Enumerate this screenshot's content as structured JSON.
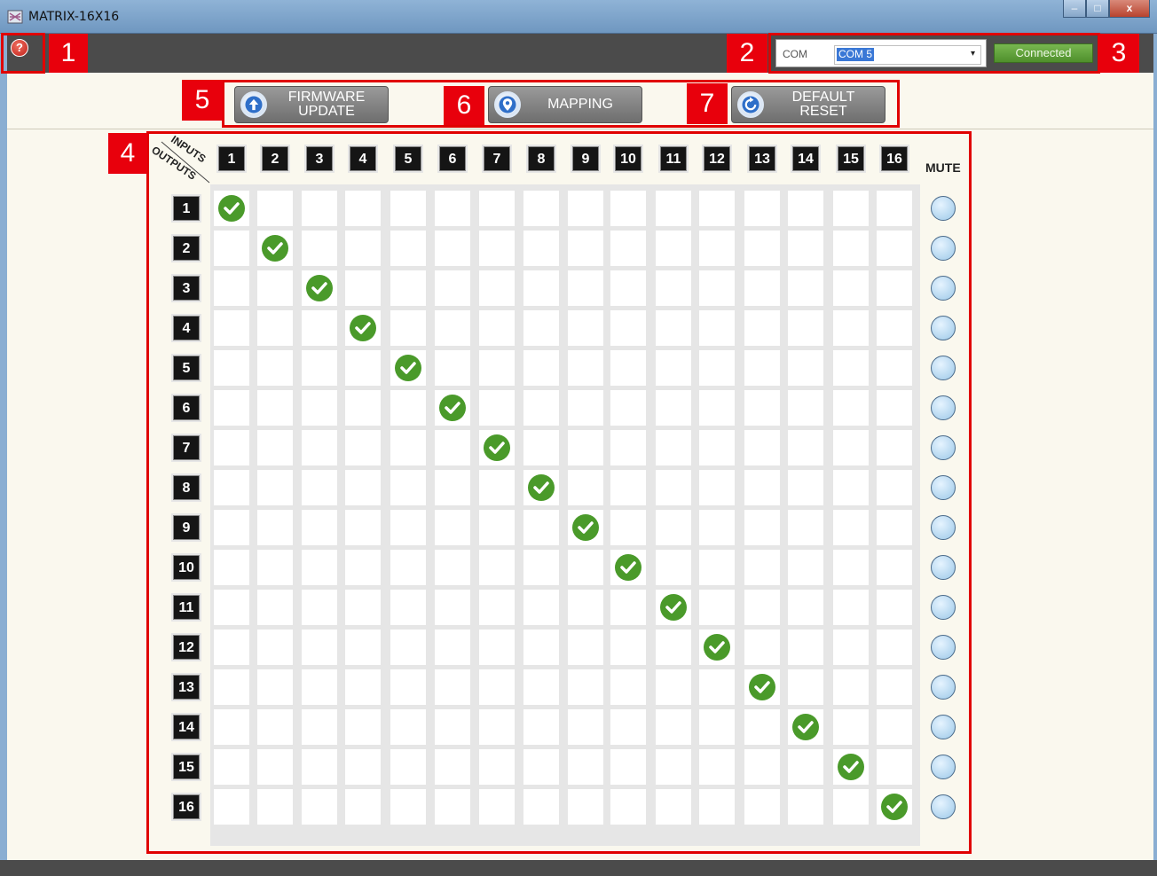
{
  "window": {
    "title": "MATRIX-16X16",
    "min_btn": "–",
    "max_btn": "□",
    "close_btn": "x"
  },
  "toolbar": {
    "help_label": "?",
    "com_label": "COM",
    "com_value": "COM 5",
    "com_arrow": "▾",
    "status": "Connected"
  },
  "actions": {
    "firmware_update": {
      "label": "FIRMWARE\nUPDATE",
      "icon": "arrow-up-circle-icon"
    },
    "mapping": {
      "label": "MAPPING",
      "icon": "location-pin-icon"
    },
    "default_reset": {
      "label": "DEFAULT\nRESET",
      "icon": "refresh-icon"
    }
  },
  "matrix": {
    "inputs_label": "INPUTS",
    "outputs_label": "OUTPUTS",
    "mute_label": "MUTE",
    "inputs": [
      "1",
      "2",
      "3",
      "4",
      "5",
      "6",
      "7",
      "8",
      "9",
      "10",
      "11",
      "12",
      "13",
      "14",
      "15",
      "16"
    ],
    "outputs": [
      "1",
      "2",
      "3",
      "4",
      "5",
      "6",
      "7",
      "8",
      "9",
      "10",
      "11",
      "12",
      "13",
      "14",
      "15",
      "16"
    ],
    "routing": [
      1,
      2,
      3,
      4,
      5,
      6,
      7,
      8,
      9,
      10,
      11,
      12,
      13,
      14,
      15,
      16
    ],
    "muted": [
      false,
      false,
      false,
      false,
      false,
      false,
      false,
      false,
      false,
      false,
      false,
      false,
      false,
      false,
      false,
      false
    ]
  },
  "callouts": [
    "1",
    "2",
    "3",
    "4",
    "5",
    "6",
    "7"
  ],
  "colors": {
    "callout": "#e8000c",
    "connected": "#5a9b34",
    "check": "#4a9a2a",
    "toolbar": "#4b4b4b"
  }
}
